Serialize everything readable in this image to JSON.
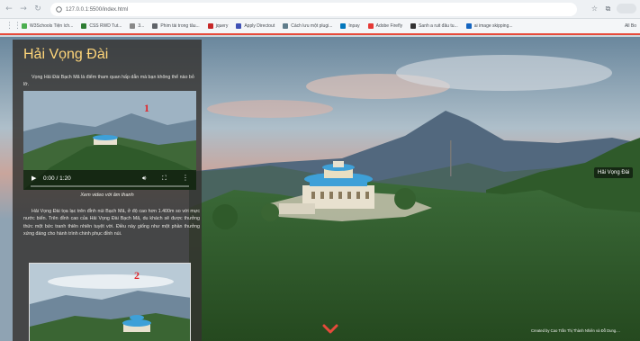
{
  "browser": {
    "url": "127.0.0.1:5500/index.html",
    "bookmarks": [
      {
        "label": "W3Schools Tiện ích...",
        "color": "#4caf50"
      },
      {
        "label": "CSS RWD Tut...",
        "color": "#2e7d32"
      },
      {
        "label": "3...",
        "color": "#888888"
      },
      {
        "label": "Phim tài trong tâu...",
        "color": "#5f6368"
      },
      {
        "label": "jquery",
        "color": "#c62828"
      },
      {
        "label": "Apply Directout",
        "color": "#3f51b5"
      },
      {
        "label": "Cách lưu một plugi...",
        "color": "#607d8b"
      },
      {
        "label": "Inpay",
        "color": "#0277bd"
      },
      {
        "label": "Adobe Firefly",
        "color": "#e53935"
      },
      {
        "label": "Sanh a ruit đâu tu...",
        "color": "#333333"
      },
      {
        "label": "ai image skipping...",
        "color": "#1565c0"
      }
    ],
    "all_bookmarks_label": "All Bo"
  },
  "panel": {
    "title": "Hải Vọng Đài",
    "intro": "Vọng Hải Đài Bạch Mã là điểm tham quan hấp dẫn mà bạn không thể nào bỏ lỡ.",
    "video": {
      "badge": "1",
      "time": "0:00 / 1:20",
      "caption": "Xem video với âm thanh"
    },
    "description": "Hải Vọng Đài tọa lạc trên đỉnh núi Bạch Mã, ở độ cao hơn 1.400m so với mực nước biển. Trên đỉnh cao của Hải Vọng Đài Bạch Mã, du khách sẽ được thưởng thức một bức tranh thiên nhiên tuyệt vời. Điều này giống như một phần thưởng xứng đáng cho hành trình chinh phục đỉnh núi.",
    "photo_badge": "2"
  },
  "hero": {
    "location_tag": "Hải Vọng Đài",
    "credit": "Created by Cao Trần Thị Thành Nhiên và Đỗ Dung...."
  },
  "colors": {
    "title": "#ffd67a",
    "badge": "#e2252a",
    "chevron": "#e64a3b",
    "bookmark_underline": "#e64a3b"
  }
}
